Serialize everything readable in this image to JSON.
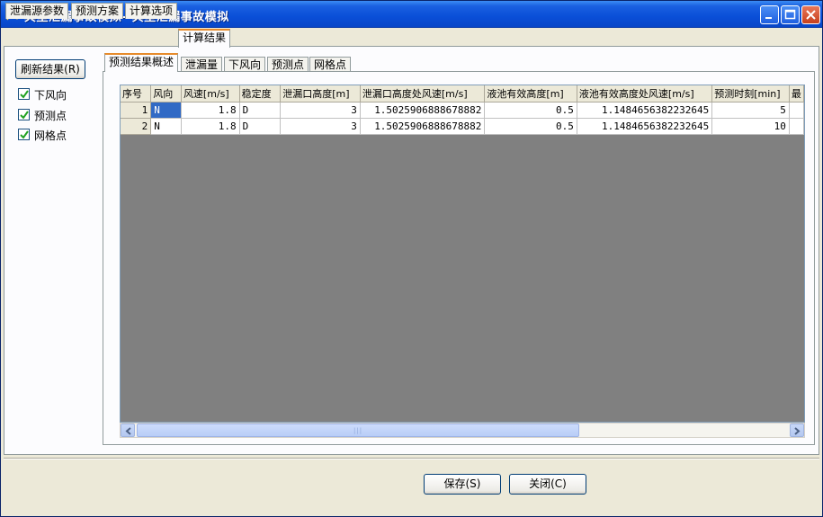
{
  "window": {
    "title": "典型泄漏事故模拟--典型泄漏事故模拟"
  },
  "main_tabs": [
    "泄漏源参数",
    "预测方案",
    "计算选项",
    "计算结果"
  ],
  "main_active_tab": "计算结果",
  "left_panel": {
    "refresh_label": "刷新结果(R)",
    "checkboxes": [
      {
        "label": "下风向",
        "checked": true
      },
      {
        "label": "预测点",
        "checked": true
      },
      {
        "label": "网格点",
        "checked": true
      }
    ]
  },
  "sub_tabs": [
    "预测结果概述",
    "泄漏量",
    "下风向",
    "预测点",
    "网格点"
  ],
  "sub_active_tab": "预测结果概述",
  "grid": {
    "columns": [
      "序号",
      "风向",
      "风速[m/s]",
      "稳定度",
      "泄漏口高度[m]",
      "泄漏口高度处风速[m/s]",
      "液池有效高度[m]",
      "液池有效高度处风速[m/s]",
      "预测时刻[min]",
      "最"
    ],
    "rows": [
      [
        "1",
        "N",
        "1.8",
        "D",
        "3",
        "1.5025906888678882",
        "0.5",
        "1.1484656382232645",
        "5",
        ""
      ],
      [
        "2",
        "N",
        "1.8",
        "D",
        "3",
        "1.5025906888678882",
        "0.5",
        "1.1484656382232645",
        "10",
        ""
      ]
    ],
    "scrollbar_grip": "|||"
  },
  "footer": {
    "save_label": "保存(S)",
    "close_label": "关闭(C)"
  },
  "colors": {
    "titlebar": "#0a4fd8",
    "active_tab_accent": "#e68b2c",
    "selection": "#316ac5",
    "grid_empty": "#808080"
  }
}
